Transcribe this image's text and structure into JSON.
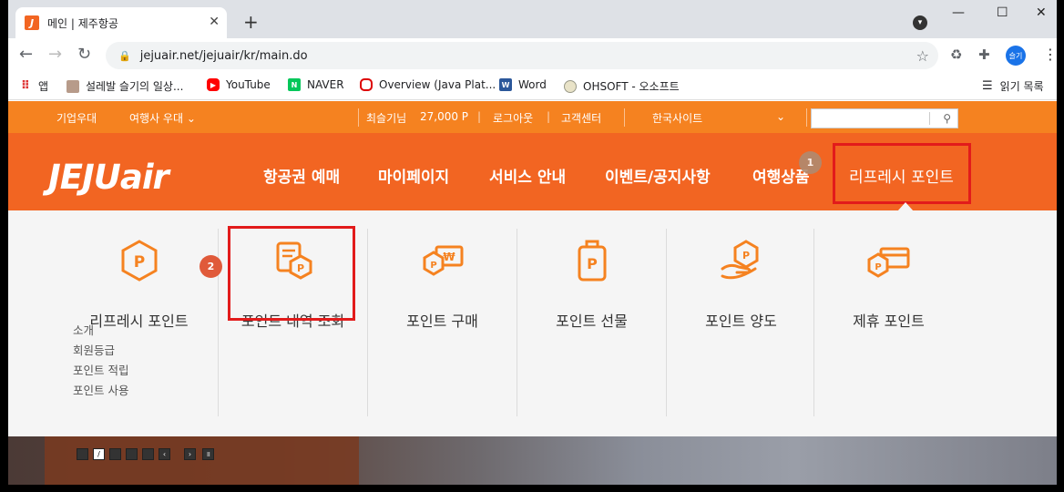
{
  "browser": {
    "tab_title": "메인 | 제주항공",
    "tab_favicon": "J",
    "url": "jejuair.net/jejuair/kr/main.do",
    "profile_label": "슬기"
  },
  "bookmarks": {
    "items": [
      {
        "label": "앱"
      },
      {
        "label": "설레발 슬기의 일상..."
      },
      {
        "label": "YouTube"
      },
      {
        "label": "NAVER"
      },
      {
        "label": "Overview (Java Plat..."
      },
      {
        "label": "Word"
      },
      {
        "label": "OHSOFT - 오소프트"
      }
    ],
    "reading_list": "읽기 목록"
  },
  "util": {
    "corporate": "기업우대",
    "agency": "여행사 우대",
    "member_name": "최슬기님",
    "points": "27,000 P",
    "logout": "로그아웃",
    "customer_center": "고객센터",
    "site_select": "한국사이트"
  },
  "nav": {
    "logo": "JEJUair",
    "items": [
      "항공권 예매",
      "마이페이지",
      "서비스 안내",
      "이벤트/공지사항",
      "여행상품",
      "리프레시 포인트"
    ]
  },
  "annotations": {
    "badge1": "1",
    "badge2": "2"
  },
  "panel": {
    "columns": [
      {
        "title": "리프레시 포인트",
        "icon": "point-icon"
      },
      {
        "title": "포인트 내역 조회",
        "icon": "point-history-icon"
      },
      {
        "title": "포인트 구매",
        "icon": "point-purchase-icon"
      },
      {
        "title": "포인트 선물",
        "icon": "point-gift-icon"
      },
      {
        "title": "포인트 양도",
        "icon": "point-transfer-icon"
      },
      {
        "title": "제휴 포인트",
        "icon": "partner-point-icon"
      }
    ],
    "sublinks": [
      "소개",
      "회원등급",
      "포인트 적립",
      "포인트 사용"
    ]
  },
  "colors": {
    "brand_orange": "#f26522",
    "util_orange": "#f58220",
    "highlight_red": "#e21b1b",
    "icon_orange": "#f58220"
  }
}
